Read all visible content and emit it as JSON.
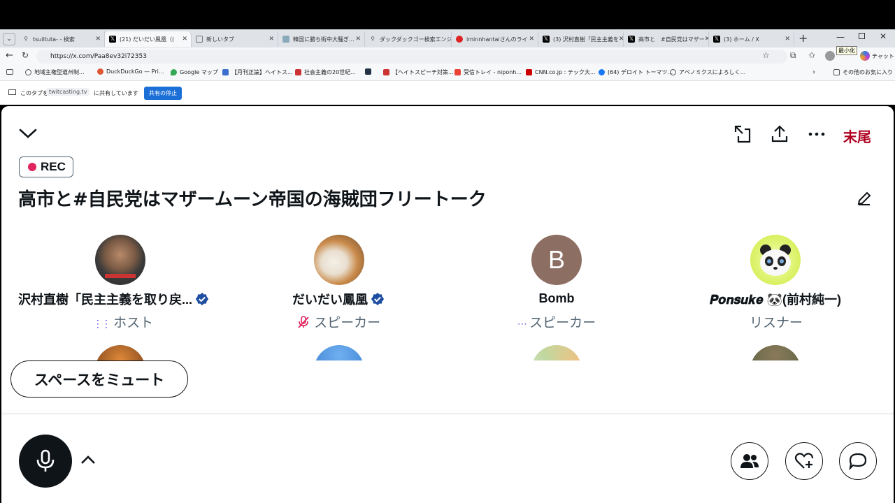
{
  "browser": {
    "tabs": [
      {
        "title": "tsuiltuta- - 検索",
        "icon": "search-icon"
      },
      {
        "title": "(21) だいだい鳳凰（(",
        "icon": "x-logo-icon"
      },
      {
        "title": "新しいタブ",
        "icon": "page-icon"
      },
      {
        "title": "韓国に勝ち街中大騒ぎ...",
        "icon": "bird-icon"
      },
      {
        "title": "ダックダックゴー検索エンジン",
        "icon": "search-icon"
      },
      {
        "title": "iminnhantaiさんのライ",
        "icon": "twitcasting-icon"
      },
      {
        "title": "(3) 沢村直樹「民主主義を",
        "icon": "x-logo-icon"
      },
      {
        "title": "高市と　#自民党はマザー",
        "icon": "x-logo-icon"
      },
      {
        "title": "(3) ホーム / X",
        "icon": "x-logo-icon"
      }
    ],
    "url": "https://x.com/Paa8ev32i72353",
    "zoom_tooltip": "最小化",
    "chat_label": "チャット",
    "bookmarks": [
      "地域主権型道州制...",
      "DuckDuckGo — Pri...",
      "Google マップ",
      "【月刊正論】ヘイトス...",
      "社会主義の20世紀...",
      "【ヘイトスピーチ対策...",
      "受信トレイ - niponh...",
      "CNN.co.jp : テック大...",
      "(64) デロイト トーマツ...",
      "アベノミクスによろしく..."
    ],
    "other_bookmarks": "その他のお気に入り",
    "share_prefix": "このタブを",
    "share_site": "twitcasting.tv",
    "share_suffix": "に共有しています",
    "share_stop": "共有の停止"
  },
  "space": {
    "end_label": "末尾",
    "rec_label": "REC",
    "title": "高市と#自民党はマザームーン帝国の海賊団フリートーク",
    "participants": [
      {
        "name": "沢村直樹「民主主義を取り戻...",
        "role": "ホスト",
        "verified": true,
        "role_icon": "audio-wave-icon"
      },
      {
        "name": "だいだい鳳凰",
        "role": "スピーカー",
        "verified": true,
        "role_icon": "mic-muted-icon"
      },
      {
        "name": "Bomb",
        "role": "スピーカー",
        "verified": false,
        "role_icon": "audio-wave-icon",
        "initial": "B"
      },
      {
        "name": "𝑷𝒐𝒏𝒔𝒖𝒌𝒆 🐼(前村純一)",
        "role": "リスナー",
        "verified": false,
        "role_icon": ""
      }
    ],
    "mute_button": "スペースをミュート",
    "colors": {
      "accent": "#1d9bf0",
      "end": "#b00020",
      "rec": "#e0245e",
      "verified": "#1d4ea1"
    }
  }
}
